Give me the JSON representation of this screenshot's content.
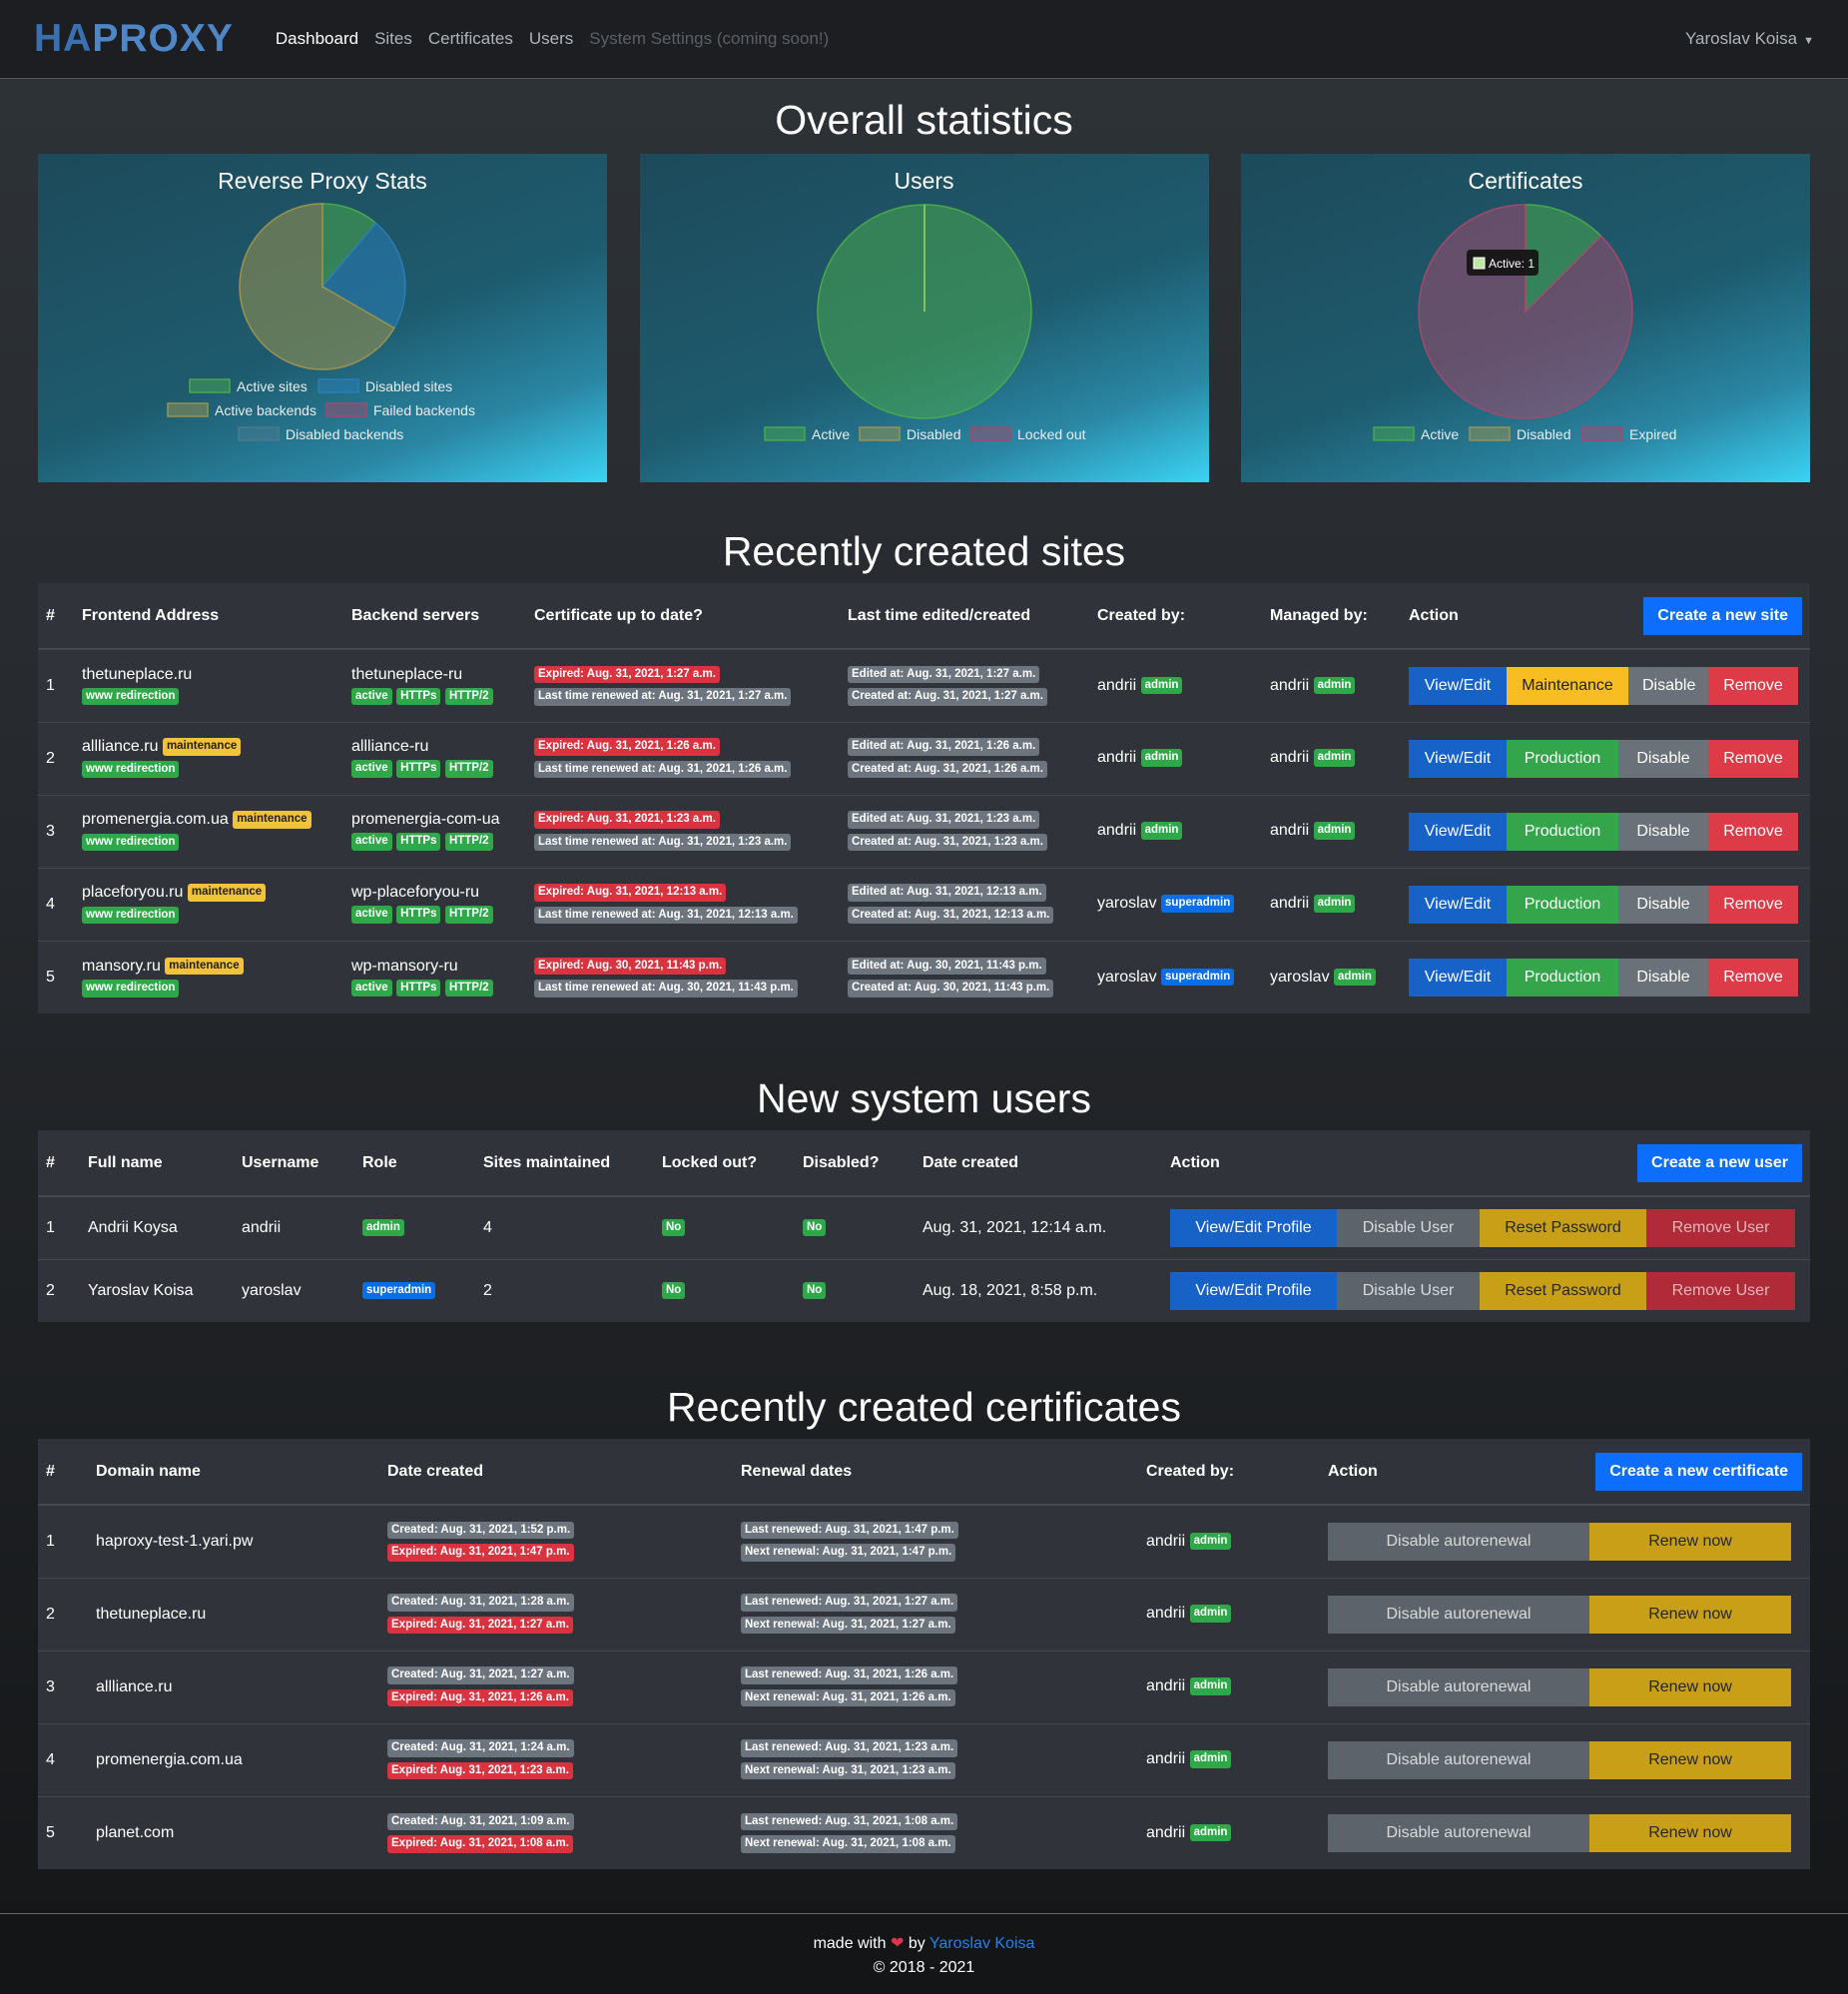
{
  "nav": {
    "brand_ha": "HA",
    "brand_proxy": "PROXY",
    "links": [
      "Dashboard",
      "Sites",
      "Certificates",
      "Users",
      "System Settings (coming soon!)"
    ],
    "user": "Yaroslav Koisa"
  },
  "overall": {
    "title": "Overall statistics"
  },
  "chart_data": [
    {
      "type": "pie",
      "title": "Reverse Proxy Stats",
      "categories": [
        "Active sites",
        "Disabled sites",
        "Active backends",
        "Failed backends",
        "Disabled backends"
      ],
      "values": [
        1,
        2,
        6,
        0,
        0
      ],
      "colors": [
        "#48a84e",
        "#2a7db8",
        "#9a9350",
        "#a04a6e",
        "#4a7a90"
      ],
      "legend": "bottom"
    },
    {
      "type": "pie",
      "title": "Users",
      "categories": [
        "Active",
        "Disabled",
        "Locked out"
      ],
      "values": [
        2,
        0,
        0
      ],
      "colors": [
        "#48a84e",
        "#9a9350",
        "#a04a6e"
      ],
      "legend": "bottom"
    },
    {
      "type": "pie",
      "title": "Certificates",
      "categories": [
        "Active",
        "Disabled",
        "Expired"
      ],
      "values": [
        1,
        0,
        7
      ],
      "colors": [
        "#48a84e",
        "#9a9350",
        "#a04a6e"
      ],
      "legend": "bottom",
      "tooltip": "Active: 1"
    }
  ],
  "sites": {
    "title": "Recently created sites",
    "headers": [
      "#",
      "Frontend Address",
      "Backend servers",
      "Certificate up to date?",
      "Last time edited/created",
      "Created by:",
      "Managed by:",
      "Action"
    ],
    "create_button": "Create a new site",
    "rows": [
      {
        "num": "1",
        "frontend": "thetuneplace.ru",
        "maint": "",
        "redirect": "www redirection",
        "backend": "thetuneplace-ru",
        "b1": "active",
        "b2": "HTTPs",
        "b3": "HTTP/2",
        "expired": "Expired: Aug. 31, 2021, 1:27 a.m.",
        "renewed": "Last time renewed at: Aug. 31, 2021, 1:27 a.m.",
        "edited": "Edited at: Aug. 31, 2021, 1:27 a.m.",
        "created": "Created at: Aug. 31, 2021, 1:27 a.m.",
        "created_by": "andrii",
        "created_role": "admin",
        "managed_by": "andrii",
        "managed_role": "admin",
        "a1": "View/Edit",
        "a2": "Maintenance",
        "a3": "Disable",
        "a4": "Remove"
      },
      {
        "num": "2",
        "frontend": "allliance.ru",
        "maint": "maintenance",
        "redirect": "www redirection",
        "backend": "allliance-ru",
        "b1": "active",
        "b2": "HTTPs",
        "b3": "HTTP/2",
        "expired": "Expired: Aug. 31, 2021, 1:26 a.m.",
        "renewed": "Last time renewed at: Aug. 31, 2021, 1:26 a.m.",
        "edited": "Edited at: Aug. 31, 2021, 1:26 a.m.",
        "created": "Created at: Aug. 31, 2021, 1:26 a.m.",
        "created_by": "andrii",
        "created_role": "admin",
        "managed_by": "andrii",
        "managed_role": "admin",
        "a1": "View/Edit",
        "a2": "Production",
        "a3": "Disable",
        "a4": "Remove"
      },
      {
        "num": "3",
        "frontend": "promenergia.com.ua",
        "maint": "maintenance",
        "redirect": "www redirection",
        "backend": "promenergia-com-ua",
        "b1": "active",
        "b2": "HTTPs",
        "b3": "HTTP/2",
        "expired": "Expired: Aug. 31, 2021, 1:23 a.m.",
        "renewed": "Last time renewed at: Aug. 31, 2021, 1:23 a.m.",
        "edited": "Edited at: Aug. 31, 2021, 1:23 a.m.",
        "created": "Created at: Aug. 31, 2021, 1:23 a.m.",
        "created_by": "andrii",
        "created_role": "admin",
        "managed_by": "andrii",
        "managed_role": "admin",
        "a1": "View/Edit",
        "a2": "Production",
        "a3": "Disable",
        "a4": "Remove"
      },
      {
        "num": "4",
        "frontend": "placeforyou.ru",
        "maint": "maintenance",
        "redirect": "www redirection",
        "backend": "wp-placeforyou-ru",
        "b1": "active",
        "b2": "HTTPs",
        "b3": "HTTP/2",
        "expired": "Expired: Aug. 31, 2021, 12:13 a.m.",
        "renewed": "Last time renewed at: Aug. 31, 2021, 12:13 a.m.",
        "edited": "Edited at: Aug. 31, 2021, 12:13 a.m.",
        "created": "Created at: Aug. 31, 2021, 12:13 a.m.",
        "created_by": "yaroslav",
        "created_role": "superadmin",
        "managed_by": "andrii",
        "managed_role": "admin",
        "a1": "View/Edit",
        "a2": "Production",
        "a3": "Disable",
        "a4": "Remove"
      },
      {
        "num": "5",
        "frontend": "mansory.ru",
        "maint": "maintenance",
        "redirect": "www redirection",
        "backend": "wp-mansory-ru",
        "b1": "active",
        "b2": "HTTPs",
        "b3": "HTTP/2",
        "expired": "Expired: Aug. 30, 2021, 11:43 p.m.",
        "renewed": "Last time renewed at: Aug. 30, 2021, 11:43 p.m.",
        "edited": "Edited at: Aug. 30, 2021, 11:43 p.m.",
        "created": "Created at: Aug. 30, 2021, 11:43 p.m.",
        "created_by": "yaroslav",
        "created_role": "superadmin",
        "managed_by": "yaroslav",
        "managed_role": "admin",
        "a1": "View/Edit",
        "a2": "Production",
        "a3": "Disable",
        "a4": "Remove"
      }
    ]
  },
  "users": {
    "title": "New system users",
    "headers": [
      "#",
      "Full name",
      "Username",
      "Role",
      "Sites maintained",
      "Locked out?",
      "Disabled?",
      "Date created",
      "Action"
    ],
    "create_button": "Create a new user",
    "rows": [
      {
        "num": "1",
        "full": "Andrii Koysa",
        "username": "andrii",
        "role": "admin",
        "sites": "4",
        "locked": "No",
        "disabled": "No",
        "date": "Aug. 31, 2021, 12:14 a.m.",
        "a1": "View/Edit Profile",
        "a2": "Disable User",
        "a3": "Reset Password",
        "a4": "Remove User"
      },
      {
        "num": "2",
        "full": "Yaroslav Koisa",
        "username": "yaroslav",
        "role": "superadmin",
        "sites": "2",
        "locked": "No",
        "disabled": "No",
        "date": "Aug. 18, 2021, 8:58 p.m.",
        "a1": "View/Edit Profile",
        "a2": "Disable User",
        "a3": "Reset Password",
        "a4": "Remove User"
      }
    ]
  },
  "certs": {
    "title": "Recently created certificates",
    "headers": [
      "#",
      "Domain name",
      "Date created",
      "Renewal dates",
      "Created by:",
      "Action"
    ],
    "create_button": "Create a new certificate",
    "rows": [
      {
        "num": "1",
        "domain": "haproxy-test-1.yari.pw",
        "created": "Created: Aug. 31, 2021, 1:52 p.m.",
        "expired": "Expired: Aug. 31, 2021, 1:47 p.m.",
        "last": "Last renewed: Aug. 31, 2021, 1:47 p.m.",
        "next": "Next renewal: Aug. 31, 2021, 1:47 p.m.",
        "by": "andrii",
        "role": "admin",
        "a1": "Disable autorenewal",
        "a2": "Renew now"
      },
      {
        "num": "2",
        "domain": "thetuneplace.ru",
        "created": "Created: Aug. 31, 2021, 1:28 a.m.",
        "expired": "Expired: Aug. 31, 2021, 1:27 a.m.",
        "last": "Last renewed: Aug. 31, 2021, 1:27 a.m.",
        "next": "Next renewal: Aug. 31, 2021, 1:27 a.m.",
        "by": "andrii",
        "role": "admin",
        "a1": "Disable autorenewal",
        "a2": "Renew now"
      },
      {
        "num": "3",
        "domain": "allliance.ru",
        "created": "Created: Aug. 31, 2021, 1:27 a.m.",
        "expired": "Expired: Aug. 31, 2021, 1:26 a.m.",
        "last": "Last renewed: Aug. 31, 2021, 1:26 a.m.",
        "next": "Next renewal: Aug. 31, 2021, 1:26 a.m.",
        "by": "andrii",
        "role": "admin",
        "a1": "Disable autorenewal",
        "a2": "Renew now"
      },
      {
        "num": "4",
        "domain": "promenergia.com.ua",
        "created": "Created: Aug. 31, 2021, 1:24 a.m.",
        "expired": "Expired: Aug. 31, 2021, 1:23 a.m.",
        "last": "Last renewed: Aug. 31, 2021, 1:23 a.m.",
        "next": "Next renewal: Aug. 31, 2021, 1:23 a.m.",
        "by": "andrii",
        "role": "admin",
        "a1": "Disable autorenewal",
        "a2": "Renew now"
      },
      {
        "num": "5",
        "domain": "planet.com",
        "created": "Created: Aug. 31, 2021, 1:09 a.m.",
        "expired": "Expired: Aug. 31, 2021, 1:08 a.m.",
        "last": "Last renewed: Aug. 31, 2021, 1:08 a.m.",
        "next": "Next renewal: Aug. 31, 2021, 1:08 a.m.",
        "by": "andrii",
        "role": "admin",
        "a1": "Disable autorenewal",
        "a2": "Renew now"
      }
    ]
  },
  "footer": {
    "made": "made with",
    "heart": "❤",
    "by": "by",
    "author": "Yaroslav Koisa",
    "copyright": "© 2018 - 2021"
  }
}
